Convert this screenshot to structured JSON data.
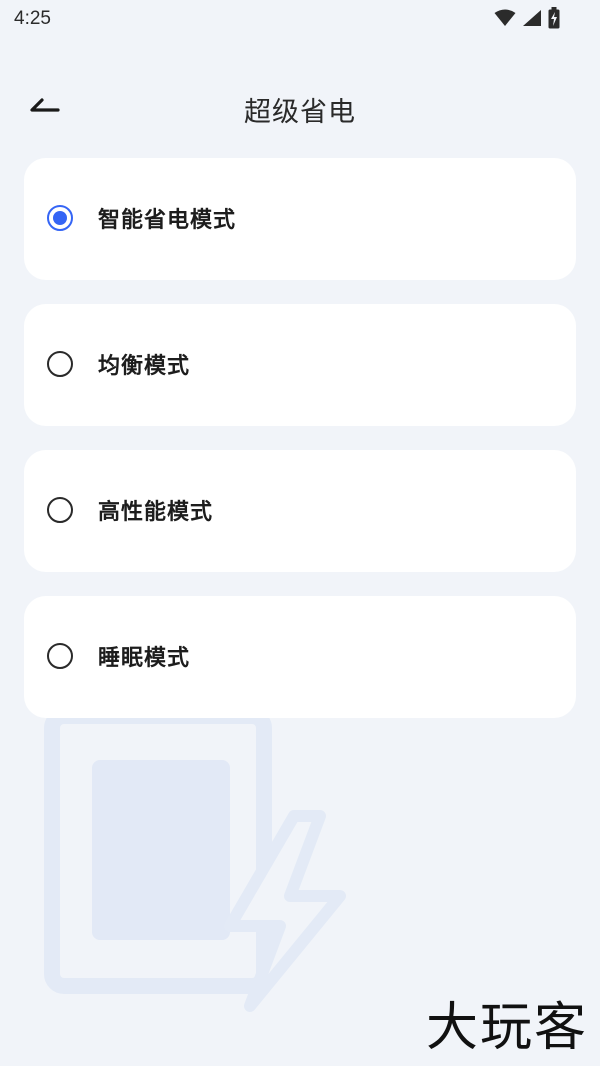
{
  "status_bar": {
    "time": "4:25",
    "icons": [
      "wifi-icon",
      "signal-icon",
      "battery-charging-icon"
    ]
  },
  "header": {
    "back_icon": "back-arrow-icon",
    "title": "超级省电"
  },
  "options": [
    {
      "label": "智能省电模式",
      "selected": true
    },
    {
      "label": "均衡模式",
      "selected": false
    },
    {
      "label": "高性能模式",
      "selected": false
    },
    {
      "label": "睡眠模式",
      "selected": false
    }
  ],
  "colors": {
    "background": "#f1f4f9",
    "card": "#ffffff",
    "accent": "#3565f5",
    "illustration": "#dde6f5"
  },
  "watermark": "大玩客"
}
